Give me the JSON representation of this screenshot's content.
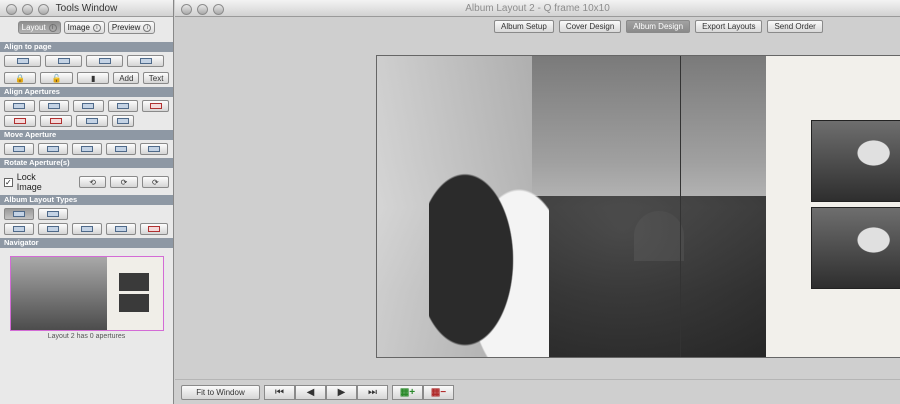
{
  "tools_window": {
    "title": "Tools Window",
    "tabs": [
      {
        "label": "Layout",
        "active": true
      },
      {
        "label": "Image",
        "active": false
      },
      {
        "label": "Preview",
        "active": false
      }
    ],
    "sections": {
      "align_to_page": "Align to page",
      "align_apertures": "Align Apertures",
      "move_aperture": "Move Aperture",
      "rotate_apertures": "Rotate Aperture(s)",
      "album_layout_types": "Album Layout Types",
      "navigator": "Navigator"
    },
    "add_label": "Add",
    "text_label": "Text",
    "lock_image_label": "Lock Image",
    "lock_image_checked": true,
    "navigator_caption": "Layout 2 has 0 apertures"
  },
  "main_window": {
    "title": "Album Layout 2 - Q frame 10x10",
    "steps": [
      {
        "label": "Album Setup",
        "active": false
      },
      {
        "label": "Cover Design",
        "active": false
      },
      {
        "label": "Album Design",
        "active": true
      },
      {
        "label": "Export Layouts",
        "active": false
      },
      {
        "label": "Send Order",
        "active": false
      }
    ],
    "fit_to_window_label": "Fit to Window",
    "nav_buttons": [
      "⏮",
      "◀",
      "▶",
      "⏭"
    ]
  },
  "colors": {
    "section_header": "#8e98a4",
    "navigator_border": "#d36bd6",
    "active_step": "#8f8f8f"
  },
  "icons": [
    "close-icon",
    "minimize-icon",
    "zoom-icon",
    "align-icon",
    "lock-icon",
    "unlock-icon",
    "trash-icon",
    "rotate-icon",
    "first-page-icon",
    "prev-page-icon",
    "next-page-icon",
    "last-page-icon",
    "add-layout-icon",
    "remove-layout-icon"
  ]
}
